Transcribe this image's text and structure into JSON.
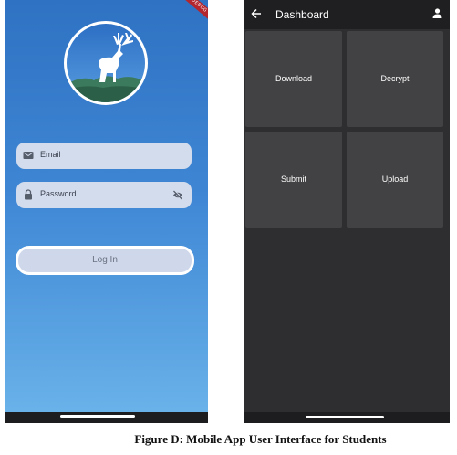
{
  "login_screen": {
    "status_text": "···· ··",
    "debug_ribbon": "DEBUG",
    "logo_icon": "deer-icon",
    "email_field": {
      "placeholder": "Email",
      "icon": "mail-icon"
    },
    "password_field": {
      "placeholder": "Password",
      "icon": "lock-icon",
      "toggle_icon": "eye-off-icon"
    },
    "login_button": "Log In"
  },
  "dashboard_screen": {
    "title": "Dashboard",
    "back_icon": "arrow-back-icon",
    "profile_icon": "person-icon",
    "tiles": [
      {
        "label": "Download"
      },
      {
        "label": "Decrypt"
      },
      {
        "label": "Submit"
      },
      {
        "label": "Upload"
      }
    ]
  },
  "caption": "Figure D: Mobile App User Interface for Students",
  "colors": {
    "login_gradient_top": "#2f72c3",
    "login_gradient_bottom": "#6ab3ea",
    "field_bg": "#d3dced",
    "dashboard_bg": "#2e2e30",
    "tile_bg": "#424244",
    "app_bar_bg": "#1f1f21"
  }
}
